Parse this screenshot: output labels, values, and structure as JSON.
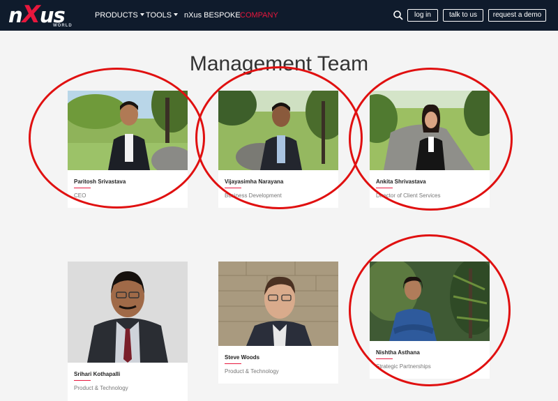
{
  "header": {
    "logo": {
      "text_pre": "n",
      "text_x": "X",
      "text_post": "us",
      "sub": "WORLD"
    },
    "nav": [
      {
        "label": "PRODUCTS",
        "dropdown": true
      },
      {
        "label": "TOOLS",
        "dropdown": true
      },
      {
        "label": "nXus BESPOKE",
        "dropdown": false
      },
      {
        "label": "COMPANY",
        "dropdown": false,
        "active": true
      }
    ],
    "buttons": {
      "login": "log in",
      "talk": "talk to us",
      "demo": "request a demo"
    }
  },
  "page": {
    "title": "Management Team"
  },
  "team": [
    {
      "name": "Paritosh Srivastava",
      "role": "CEO"
    },
    {
      "name": "Vijayasimha Narayana",
      "role": "Business Development"
    },
    {
      "name": "Ankita Shrivastava",
      "role": "Director of Client Services"
    },
    {
      "name": "Srihari Kothapalli",
      "role": "Product & Technology"
    },
    {
      "name": "Steve Woods",
      "role": "Product & Technology"
    },
    {
      "name": "Nishtha Asthana",
      "role": "Strategic Partnerships"
    }
  ],
  "colors": {
    "nav_bg": "#0f1b2c",
    "accent": "#e8173d",
    "annotation": "#e01010"
  },
  "icons": {
    "search": "search-icon",
    "caret": "chevron-down-icon"
  }
}
